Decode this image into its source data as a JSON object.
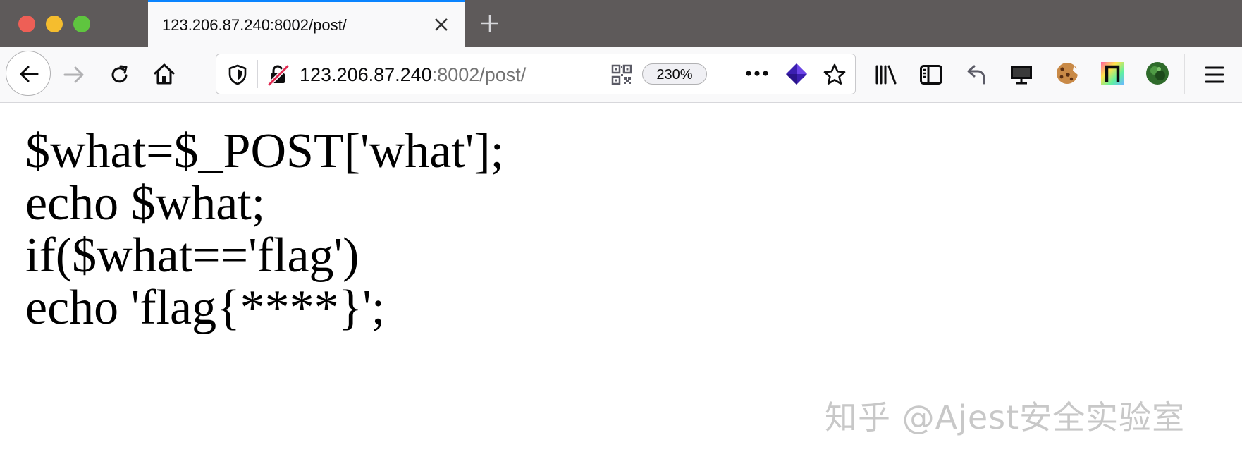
{
  "tab": {
    "title": "123.206.87.240:8002/post/"
  },
  "urlbar": {
    "host": "123.206.87.240",
    "rest": ":8002/post/",
    "zoom": "230%"
  },
  "content": {
    "lines": [
      "$what=$_POST['what'];",
      "echo $what;",
      "if($what=='flag')",
      "echo 'flag{****}';"
    ]
  },
  "watermark": {
    "text": "知乎 @Ajest安全实验室"
  },
  "colors": {
    "accent": "#0a84ff",
    "tabstrip": "#5e5a5a",
    "toolbar": "#f9f9fa"
  },
  "icons": [
    "back-icon",
    "forward-icon",
    "reload-icon",
    "home-icon",
    "shield-icon",
    "insecure-lock-icon",
    "qr-code-icon",
    "more-icon",
    "extension-cube-icon",
    "star-icon",
    "library-icon",
    "sidebar-icon",
    "undo-icon",
    "monitor-icon",
    "cookie-icon",
    "extension-badge-icon",
    "avatar-icon",
    "menu-icon"
  ]
}
